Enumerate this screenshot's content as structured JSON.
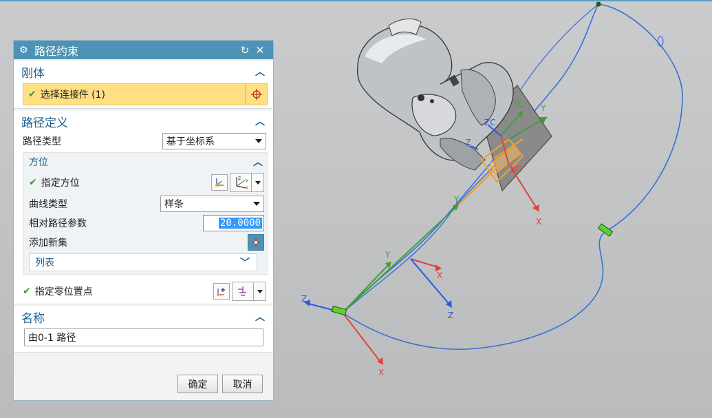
{
  "dialog": {
    "title": "路径约束",
    "reset_icon": "reset-icon",
    "close_icon": "close-icon"
  },
  "rigid": {
    "title": "刚体",
    "select_label": "选择连接件 (1)"
  },
  "path_def": {
    "title": "路径定义",
    "path_type_label": "路径类型",
    "path_type_value": "基于坐标系",
    "orientation": {
      "title": "方位",
      "specify_label": "指定方位",
      "curve_type_label": "曲线类型",
      "curve_type_value": "样条",
      "rel_param_label": "相对路径参数",
      "rel_param_value": "20.0000",
      "add_new_label": "添加新集",
      "list_label": "列表"
    },
    "zero_point_label": "指定零位置点"
  },
  "name": {
    "title": "名称",
    "value": "由0-1 路径"
  },
  "footer": {
    "ok": "确定",
    "cancel": "取消"
  },
  "viewport": {
    "axis_labels": {
      "x": "X",
      "y": "Y",
      "z": "Z",
      "xc": "XC",
      "yc": "YC",
      "zc": "ZC"
    },
    "colors": {
      "path": "#3a6fd8",
      "x_axis": "#e0413a",
      "y_axis": "#3f9f3a",
      "z_axis": "#2b58e6",
      "highlight": "#f0a030",
      "marker": "#5cd12e"
    }
  }
}
